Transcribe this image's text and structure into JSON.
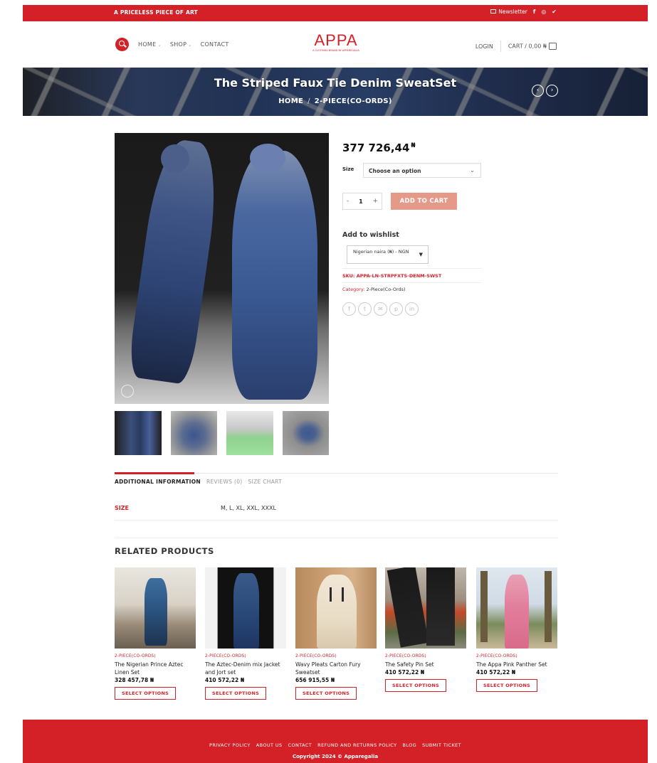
{
  "topbar": {
    "tagline": "A PRICELESS PIECE OF ART",
    "newsletter": "Newsletter",
    "social": [
      "f",
      "◎",
      "✔"
    ]
  },
  "header": {
    "nav": [
      "HOME",
      "SHOP",
      "CONTACT"
    ],
    "logo": "APPA",
    "logo_tag": "A CLOTHING BRAND BY APPAREGALIA",
    "login": "LOGIN",
    "cart": "CART / 0,00 ₦"
  },
  "banner": {
    "title": "The Striped Faux Tie Denim SweatSet",
    "crumb_home": "HOME",
    "crumb_sep": "/",
    "crumb_cat": "2-PIECE(CO-ORDS)",
    "prev": "‹",
    "next": "›"
  },
  "product": {
    "price": "377 726,44",
    "currency_symbol": "₦",
    "size_label": "Size",
    "size_placeholder": "Choose an option",
    "qty_minus": "-",
    "qty": "1",
    "qty_plus": "+",
    "add_to_cart": "ADD TO CART",
    "wishlist": "Add to wishlist",
    "currency_select": "Nigerian naira (₦) - NGN",
    "sku_label": "SKU:",
    "sku": "APPA-LN-STRPFXTS-DENM-SWST",
    "category_label": "Category:",
    "category": "2-Piece(Co-Ords)",
    "share_icons": [
      "f",
      "t",
      "✉",
      "p",
      "in"
    ]
  },
  "tabs": {
    "items": [
      "ADDITIONAL INFORMATION",
      "REVIEWS (0)",
      "SIZE CHART"
    ],
    "attr_label": "SIZE",
    "attr_value": "M, L, XL, XXL, XXXL"
  },
  "related": {
    "title": "RELATED PRODUCTS",
    "items": [
      {
        "cat": "2-PIECE(CO-ORDS)",
        "name": "The Nigerian Prince Aztec Linen Set",
        "price": "328 457,78 ₦",
        "button": "SELECT OPTIONS"
      },
      {
        "cat": "2-PIECE(CO-ORDS)",
        "name": "The Aztec-Denim mix Jacket and Jort set",
        "price": "410 572,22 ₦",
        "button": "SELECT OPTIONS"
      },
      {
        "cat": "2-PIECE(CO-ORDS)",
        "name": "Wavy Pleats Carton Fury Sweatset",
        "price": "656 915,55 ₦",
        "button": "SELECT OPTIONS"
      },
      {
        "cat": "2-PIECE(CO-ORDS)",
        "name": "The Safety Pin Set",
        "price": "410 572,22 ₦",
        "button": "SELECT OPTIONS"
      },
      {
        "cat": "2-PIECE(CO-ORDS)",
        "name": "The Appa Pink Panther Set",
        "price": "410 572,22 ₦",
        "button": "SELECT OPTIONS"
      }
    ]
  },
  "footer": {
    "links": [
      "PRIVACY POLICY",
      "ABOUT US",
      "CONTACT",
      "REFUND AND RETURNS POLICY",
      "BLOG",
      "SUBMIT TICKET"
    ],
    "copyright": "Copyright 2024 © Apparegalia"
  },
  "colors": {
    "brand_red": "#d42127",
    "add_to_cart_bg": "#e59a89"
  }
}
